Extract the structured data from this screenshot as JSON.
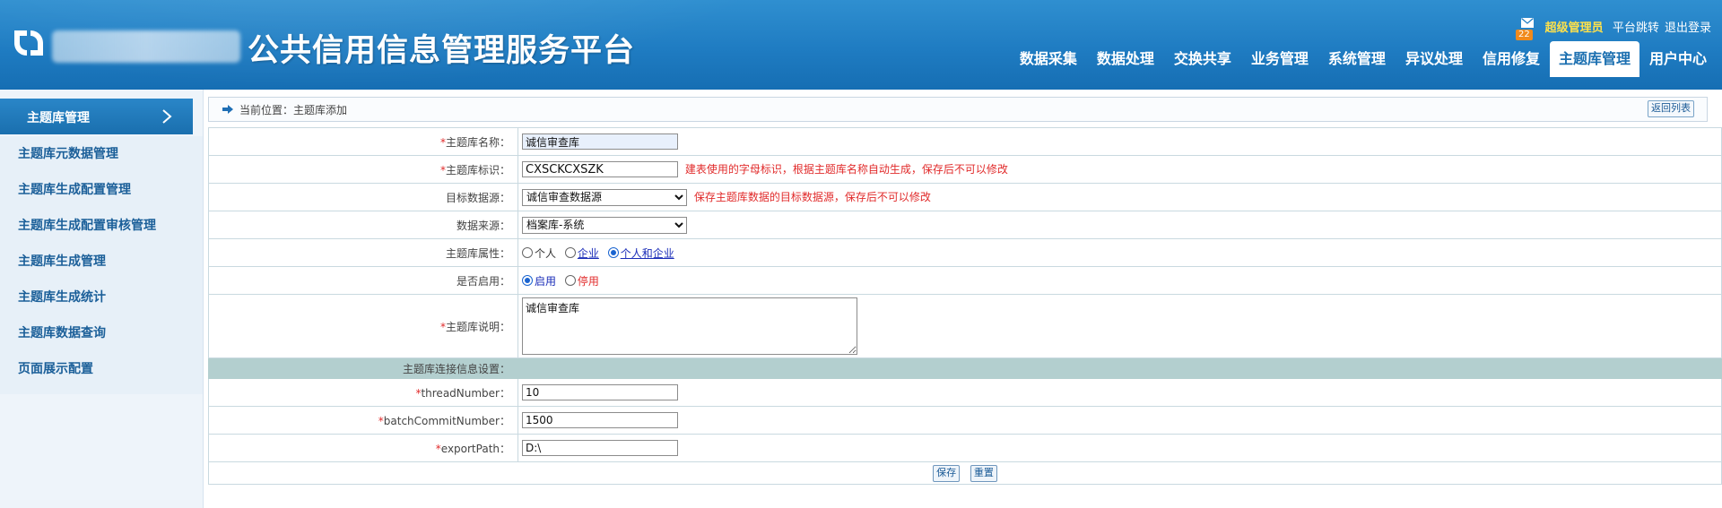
{
  "header": {
    "title": "公共信用信息管理服务平台",
    "user_role": "超级管理员",
    "platform_jump": "平台跳转",
    "logout": "退出登录",
    "mail_count": "22",
    "nav": [
      {
        "label": "数据采集",
        "active": false
      },
      {
        "label": "数据处理",
        "active": false
      },
      {
        "label": "交换共享",
        "active": false
      },
      {
        "label": "业务管理",
        "active": false
      },
      {
        "label": "系统管理",
        "active": false
      },
      {
        "label": "异议处理",
        "active": false
      },
      {
        "label": "信用修复",
        "active": false
      },
      {
        "label": "主题库管理",
        "active": true
      },
      {
        "label": "用户中心",
        "active": false
      }
    ]
  },
  "sidebar": {
    "heading": "主题库管理",
    "items": [
      {
        "label": "主题库元数据管理"
      },
      {
        "label": "主题库生成配置管理"
      },
      {
        "label": "主题库生成配置审核管理"
      },
      {
        "label": "主题库生成管理"
      },
      {
        "label": "主题库生成统计"
      },
      {
        "label": "主题库数据查询"
      },
      {
        "label": "页面展示配置"
      }
    ]
  },
  "breadcrumb": {
    "text": "当前位置：主题库添加",
    "back_label": "返回列表"
  },
  "form": {
    "name": {
      "label": "主题库名称：",
      "value": "诚信审查库"
    },
    "code": {
      "label": "主题库标识：",
      "value": "CXSCKCXSZK",
      "hint": "建表使用的字母标识，根据主题库名称自动生成，保存后不可以修改"
    },
    "target_ds": {
      "label": "目标数据源：",
      "value": "诚信审查数据源",
      "hint": "保存主题库数据的目标数据源，保存后不可以修改"
    },
    "source": {
      "label": "数据来源：",
      "value": "档案库-系统"
    },
    "attr": {
      "label": "主题库属性：",
      "options": [
        "个人",
        "企业",
        "个人和企业"
      ],
      "selected": "个人和企业"
    },
    "enabled": {
      "label": "是否启用：",
      "options": [
        "启用",
        "停用"
      ],
      "selected": "启用"
    },
    "desc": {
      "label": "主题库说明：",
      "value": "诚信审查库"
    },
    "section_title": "主题库连接信息设置：",
    "thread": {
      "label": "threadNumber：",
      "value": "10"
    },
    "batch": {
      "label": "batchCommitNumber：",
      "value": "1500"
    },
    "export": {
      "label": "exportPath：",
      "value": "D:\\"
    },
    "save_label": "保存",
    "reset_label": "重置"
  },
  "colors": {
    "header_blue": "#1f7cc2",
    "accent_yellow": "#ffe14a",
    "required_red": "#e12b2b",
    "section_bg": "#b3cfcf"
  }
}
